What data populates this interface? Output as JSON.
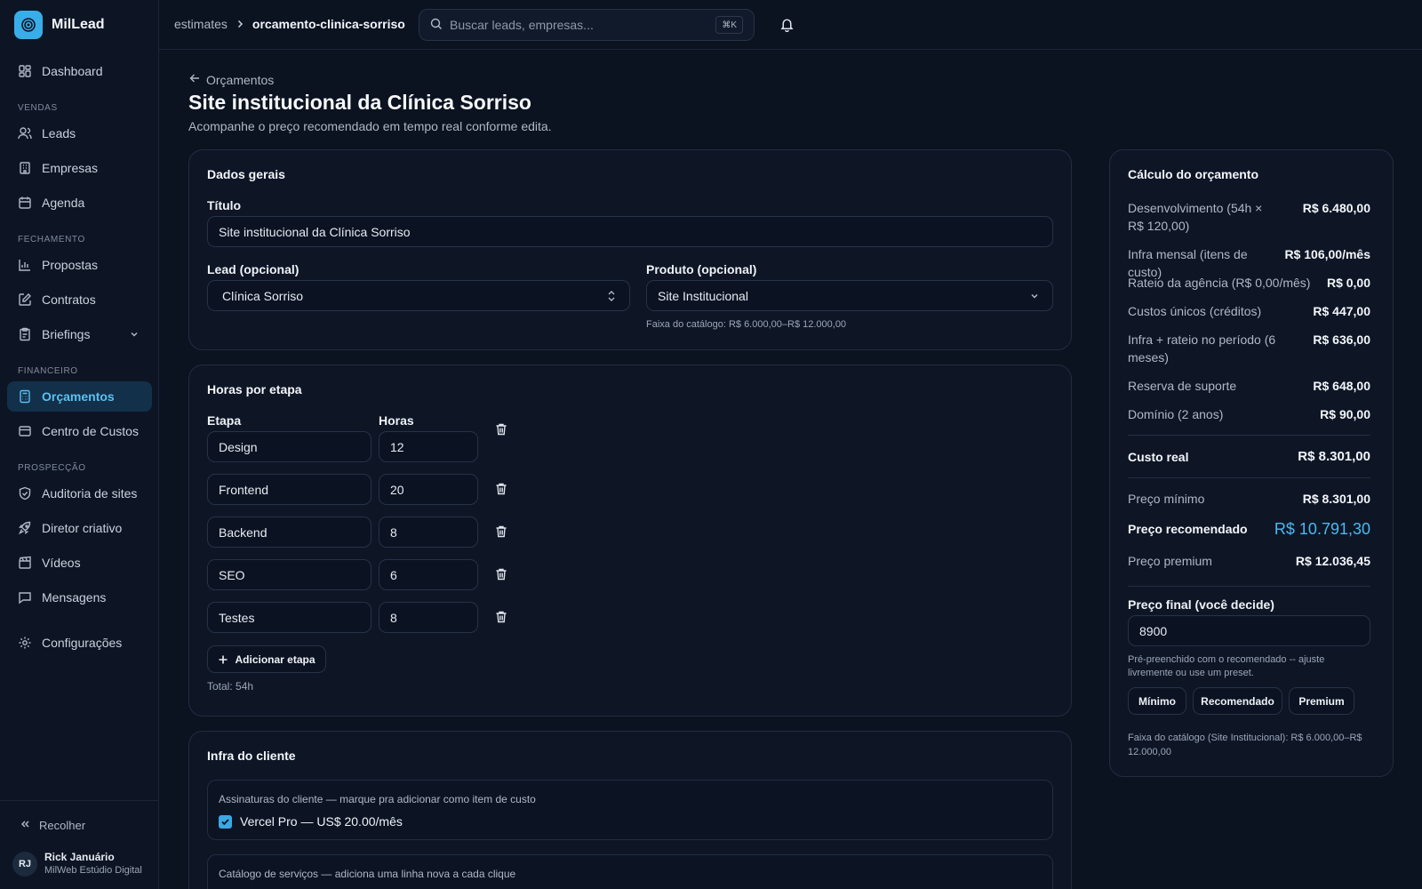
{
  "app": {
    "name": "MilLead"
  },
  "sidebar": {
    "dashboard": "Dashboard",
    "sections": {
      "vendas": "VENDAS",
      "fechamento": "FECHAMENTO",
      "financeiro": "FINANCEIRO",
      "prospeccao": "PROSPECÇÃO"
    },
    "items": {
      "leads": "Leads",
      "empresas": "Empresas",
      "agenda": "Agenda",
      "propostas": "Propostas",
      "contratos": "Contratos",
      "briefings": "Briefings",
      "orcamentos": "Orçamentos",
      "centro_custos": "Centro de Custos",
      "auditoria": "Auditoria de sites",
      "diretor": "Diretor criativo",
      "videos": "Vídeos",
      "mensagens": "Mensagens",
      "configuracoes": "Configurações"
    },
    "collapse": "Recolher",
    "user": {
      "initials": "RJ",
      "name": "Rick Januário",
      "org": "MilWeb Estúdio Digital"
    }
  },
  "topbar": {
    "breadcrumb_root": "estimates",
    "breadcrumb_current": "orcamento-clinica-sorriso",
    "search_placeholder": "Buscar leads, empresas...",
    "shortcut": "⌘K"
  },
  "header": {
    "back_label": "Orçamentos",
    "title": "Site institucional da Clínica Sorriso",
    "subtitle": "Acompanhe o preço recomendado em tempo real conforme edita."
  },
  "dados_gerais": {
    "title": "Dados gerais",
    "titulo_label": "Título",
    "titulo_value": "Site institucional da Clínica Sorriso",
    "lead_label": "Lead (opcional)",
    "lead_value": "Clínica Sorriso",
    "produto_label": "Produto (opcional)",
    "produto_value": "Site Institucional",
    "faixa_hint": "Faixa do catálogo: R$ 6.000,00–R$ 12.000,00"
  },
  "horas": {
    "title": "Horas por etapa",
    "col_etapa": "Etapa",
    "col_horas": "Horas",
    "rows": [
      {
        "etapa": "Design",
        "horas": "12"
      },
      {
        "etapa": "Frontend",
        "horas": "20"
      },
      {
        "etapa": "Backend",
        "horas": "8"
      },
      {
        "etapa": "SEO",
        "horas": "6"
      },
      {
        "etapa": "Testes",
        "horas": "8"
      }
    ],
    "add_label": "Adicionar etapa",
    "total": "Total: 54h"
  },
  "infra": {
    "title": "Infra do cliente",
    "assinaturas_caption": "Assinaturas do cliente — marque pra adicionar como item de custo",
    "assinatura_item": "Vercel Pro — US$ 20.00/mês",
    "assinatura_checked": true,
    "catalogo_caption": "Catálogo de serviços — adiciona uma linha nova a cada clique"
  },
  "calculo": {
    "title": "Cálculo do orçamento",
    "lines": [
      {
        "label": "Desenvolvimento (54h × R$ 120,00)",
        "value": "R$ 6.480,00"
      },
      {
        "label": "Infra mensal (itens de custo)",
        "value": "R$ 106,00/mês"
      },
      {
        "label": "Rateio da agência (R$ 0,00/mês)",
        "value": "R$ 0,00"
      },
      {
        "label": "Custos únicos (créditos)",
        "value": "R$ 447,00"
      },
      {
        "label": "Infra + rateio no período (6 meses)",
        "value": "R$ 636,00"
      },
      {
        "label": "Reserva de suporte",
        "value": "R$ 648,00"
      },
      {
        "label": "Domínio (2 anos)",
        "value": "R$ 90,00"
      }
    ],
    "custo_real_label": "Custo real",
    "custo_real_value": "R$ 8.301,00",
    "preco_minimo_label": "Preço mínimo",
    "preco_minimo_value": "R$ 8.301,00",
    "preco_recomendado_label": "Preço recomendado",
    "preco_recomendado_value": "R$ 10.791,30",
    "preco_premium_label": "Preço premium",
    "preco_premium_value": "R$ 12.036,45",
    "preco_final_label": "Preço final (você decide)",
    "preco_final_value": "8900",
    "preco_final_hint": "Pré-preenchido com o recomendado -- ajuste livremente ou use um preset.",
    "presets": [
      "Mínimo",
      "Recomendado",
      "Premium"
    ],
    "catalog_range": "Faixa do catálogo (Site Institucional): R$ 6.000,00–R$ 12.000,00"
  },
  "colors": {
    "accent": "#38aee8",
    "background": "#0b1220",
    "active_bg": "#12304a"
  }
}
